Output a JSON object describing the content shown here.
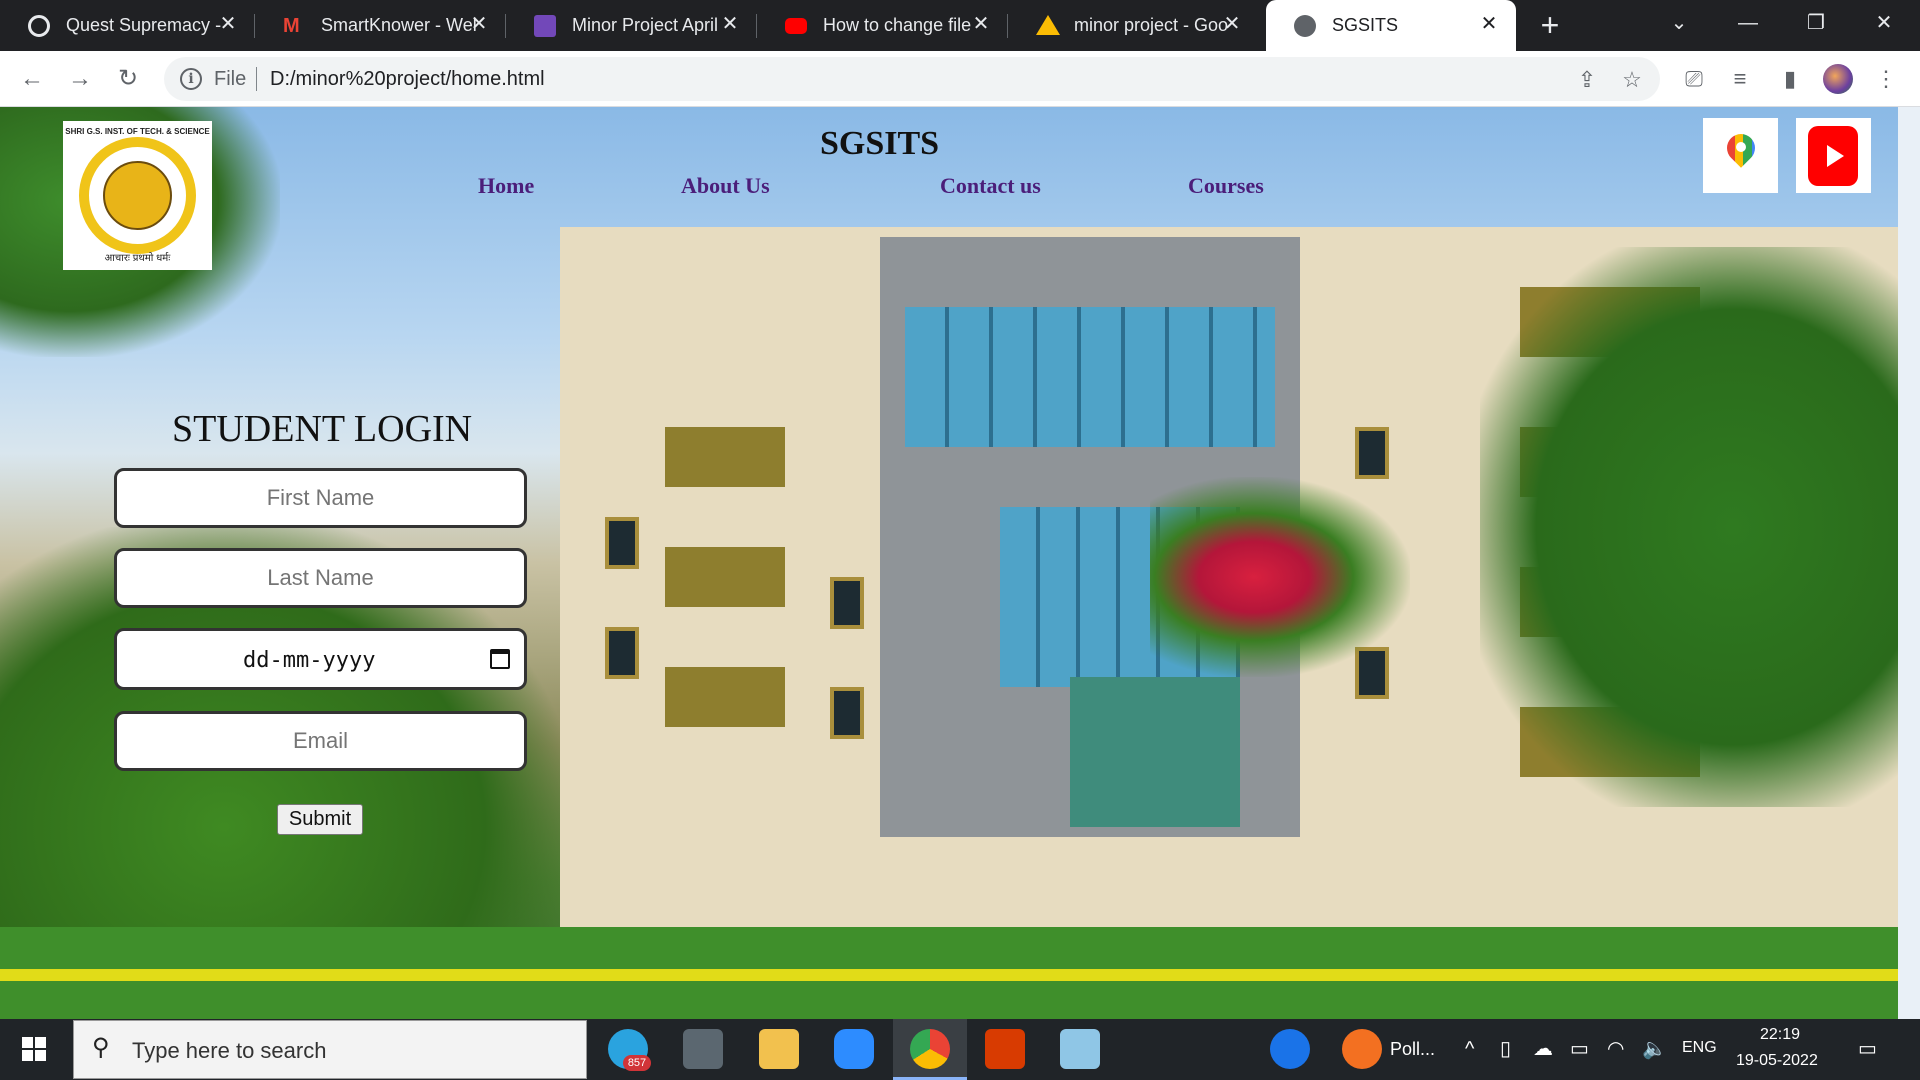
{
  "browser": {
    "tabs": [
      {
        "title": "Quest Supremacy -",
        "icon": "quest-icon"
      },
      {
        "title": "SmartKnower - Wel",
        "icon": "gmail-icon"
      },
      {
        "title": "Minor Project April",
        "icon": "forms-icon"
      },
      {
        "title": "How to change file",
        "icon": "youtube-icon"
      },
      {
        "title": "minor project - Goo",
        "icon": "drive-icon"
      },
      {
        "title": "SGSITS",
        "icon": "globe-icon",
        "active": true
      }
    ],
    "address": {
      "scheme_label": "File",
      "url": "D:/minor%20project/home.html"
    }
  },
  "page": {
    "site_title": "SGSITS",
    "nav": [
      "Home",
      "About Us",
      "Contact us",
      "Courses"
    ],
    "logo": {
      "text_top": "SHRI G.S. INST. OF TECH. & SCIENCE",
      "text_bottom": "आचारः प्रथमो धर्मः"
    },
    "social": [
      "google-maps-icon",
      "youtube-icon"
    ],
    "login": {
      "title": "STUDENT LOGIN",
      "first_name_placeholder": "First Name",
      "last_name_placeholder": "Last Name",
      "date_placeholder": "dd-mm-yyyy",
      "email_placeholder": "Email",
      "submit_label": "Submit"
    },
    "nav_color": "#4b1e7a"
  },
  "taskbar": {
    "search_placeholder": "Type here to search",
    "telegram_badge": "857",
    "notification_label": "Poll...",
    "language": "ENG",
    "time": "22:19",
    "date": "19-05-2022"
  }
}
